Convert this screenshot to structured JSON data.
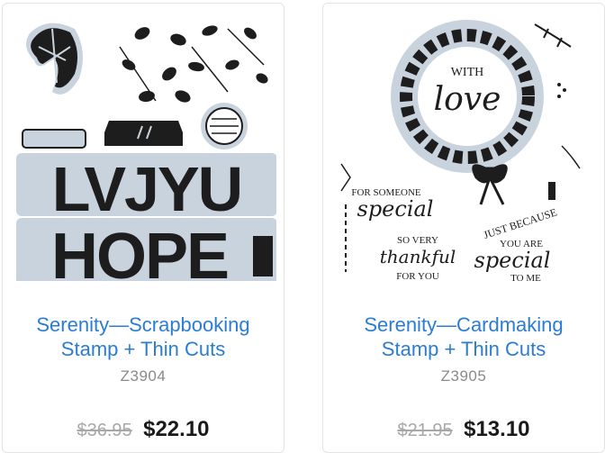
{
  "products": [
    {
      "title_line1": "Serenity—Scrapbooking",
      "title_line2": "Stamp + Thin Cuts",
      "sku": "Z3904",
      "old_price": "$36.95",
      "new_price": "$22.10",
      "image_text": "LVJYU HOPE"
    },
    {
      "title_line1": "Serenity—Cardmaking",
      "title_line2": "Stamp + Thin Cuts",
      "sku": "Z3905",
      "old_price": "$21.95",
      "new_price": "$13.10",
      "image_text": [
        "WITH",
        "love",
        "FOR SOMEONE",
        "special",
        "SO VERY",
        "thankful",
        "FOR YOU",
        "JUST BECAUSE",
        "YOU ARE",
        "special",
        "TO ME"
      ]
    }
  ]
}
